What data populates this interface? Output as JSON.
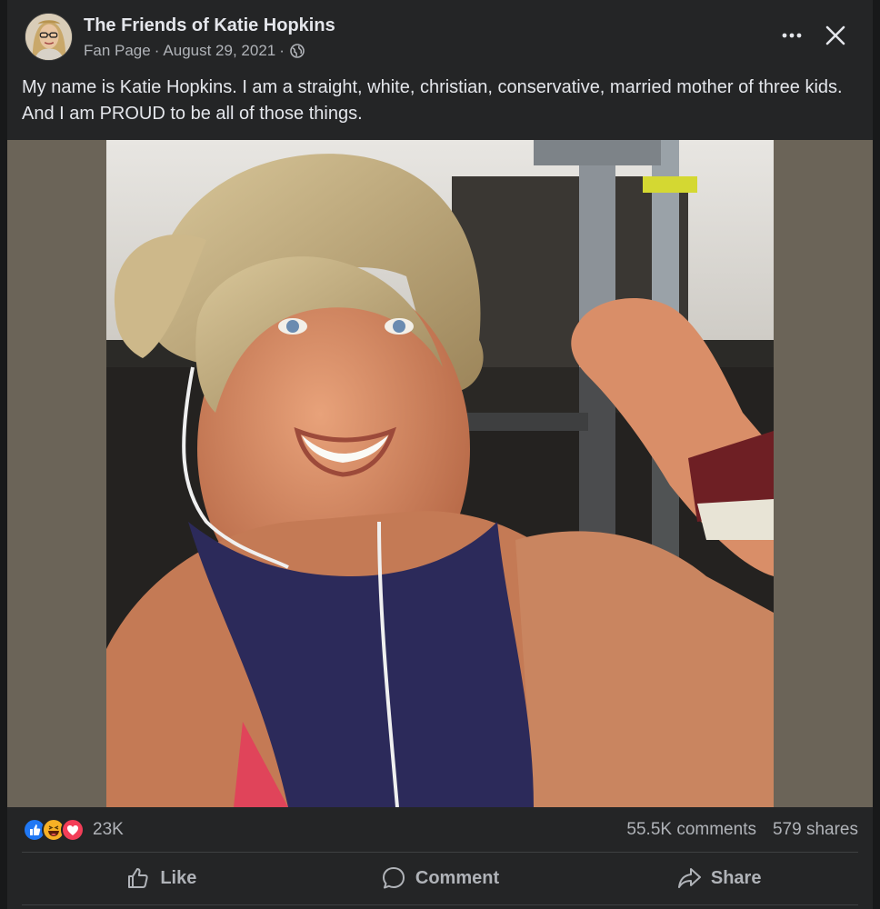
{
  "post": {
    "page_name": "The Friends of Katie Hopkins",
    "page_type": "Fan Page",
    "separator": "·",
    "date": "August 29, 2021",
    "audience_icon": "globe-icon",
    "more_icon": "more-options-icon",
    "close_icon": "close-icon",
    "text": "My name is Katie Hopkins. I am a straight, white, christian, conservative, married mother of three kids. And I am PROUD to be all of those things."
  },
  "stats": {
    "reaction_icons": [
      "like-reaction-icon",
      "haha-reaction-icon",
      "love-reaction-icon"
    ],
    "reaction_count": "23K",
    "comments": "55.5K comments",
    "shares": "579 shares"
  },
  "actions": {
    "like_label": "Like",
    "comment_label": "Comment",
    "share_label": "Share"
  },
  "colors": {
    "background": "#242526",
    "text_primary": "#e4e6eb",
    "text_secondary": "#b0b3b8",
    "like_blue": "#2078f4",
    "love_red": "#f33e58",
    "haha_yellow": "#f7b125"
  }
}
